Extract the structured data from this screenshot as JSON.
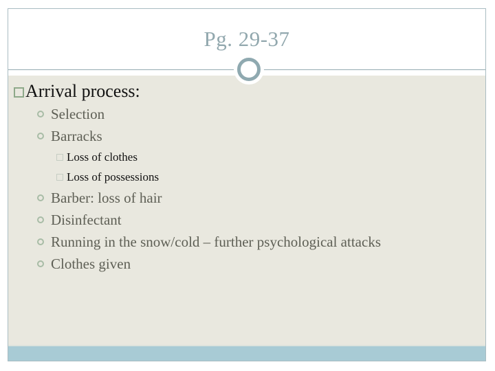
{
  "slide": {
    "title": "Pg. 29-37",
    "heading": "Arrival process:",
    "items": [
      {
        "level": 2,
        "text": "Selection"
      },
      {
        "level": 2,
        "text": "Barracks"
      },
      {
        "level": 3,
        "text": "Loss of clothes"
      },
      {
        "level": 3,
        "text": "Loss of possessions"
      },
      {
        "level": 2,
        "text": "Barber: loss of hair"
      },
      {
        "level": 2,
        "text": "Disinfectant"
      },
      {
        "level": 2,
        "text": "Running in the snow/cold – further psychological attacks"
      },
      {
        "level": 2,
        "text": "Clothes given"
      }
    ]
  },
  "theme": {
    "title_color": "#92a8ae",
    "body_bg": "#e9e8df",
    "footer_band": "#a8cbd5",
    "accent_ring": "#8fa9b0"
  }
}
